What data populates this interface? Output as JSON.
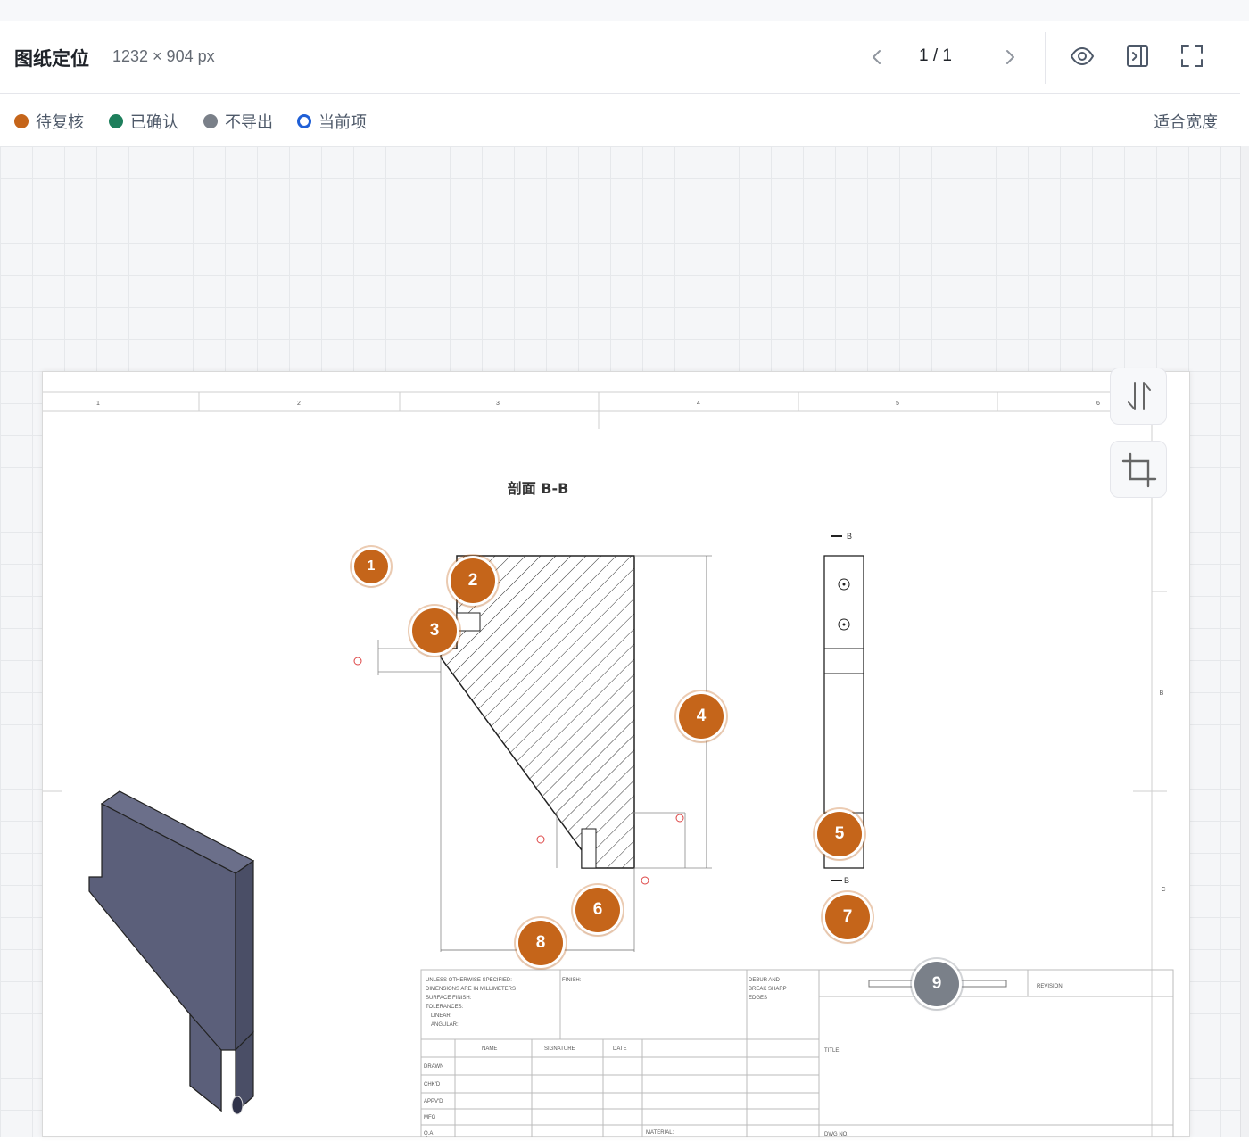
{
  "header": {
    "title": "图纸定位",
    "dimensions": "1232 × 904 px",
    "page_indicator": "1 / 1"
  },
  "legend": {
    "items": [
      {
        "label": "待复核",
        "color": "#c5651a",
        "style": "filled"
      },
      {
        "label": "已确认",
        "color": "#1e7f5c",
        "style": "filled"
      },
      {
        "label": "不导出",
        "color": "#7a8089",
        "style": "filled"
      },
      {
        "label": "当前项",
        "color": "#1f5fd6",
        "style": "ring"
      }
    ],
    "fit_width_label": "适合宽度"
  },
  "drawing": {
    "section_title": "剖面 B-B",
    "column_numbers": [
      "1",
      "2",
      "3",
      "4",
      "5",
      "6"
    ],
    "row_letters": [
      "B",
      "C"
    ],
    "section_mark": "B",
    "title_block": {
      "notes": [
        "UNLESS OTHERWISE SPECIFIED:",
        "DIMENSIONS ARE IN MILLIMETERS",
        "SURFACE FINISH:",
        "TOLERANCES:",
        "LINEAR:",
        "ANGULAR:"
      ],
      "finish": "FINISH:",
      "deburr": [
        "DEBUR AND",
        "BREAK SHARP",
        "EDGES"
      ],
      "revision": "REVISION",
      "headers": [
        "NAME",
        "SIGNATURE",
        "DATE"
      ],
      "rows": [
        "DRAWN",
        "CHK'D",
        "APPV'D",
        "MFG",
        "Q.A"
      ],
      "title_label": "TITLE:",
      "material": "MATERIAL:",
      "dwg_no": "DWG NO."
    }
  },
  "markers": [
    {
      "label": "1",
      "status": "review"
    },
    {
      "label": "2",
      "status": "review"
    },
    {
      "label": "3",
      "status": "review"
    },
    {
      "label": "4",
      "status": "review"
    },
    {
      "label": "5",
      "status": "review"
    },
    {
      "label": "6",
      "status": "review"
    },
    {
      "label": "7",
      "status": "review"
    },
    {
      "label": "8",
      "status": "review"
    },
    {
      "label": "9",
      "status": "noexport"
    }
  ],
  "icons": {
    "prev": "chevron-left-icon",
    "next": "chevron-right-icon",
    "view": "eye-icon",
    "panel": "panel-toggle-icon",
    "fullscreen": "fullscreen-icon",
    "flip": "flip-icon",
    "crop": "crop-icon"
  }
}
